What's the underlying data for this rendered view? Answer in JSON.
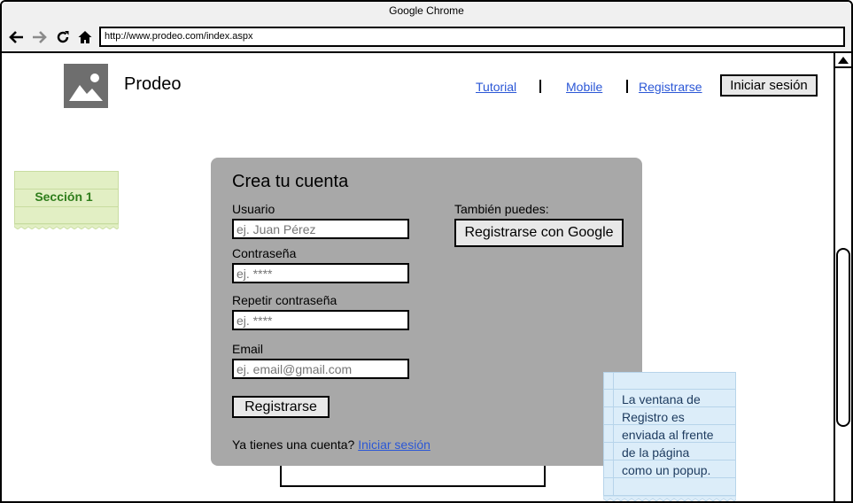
{
  "window": {
    "title": "Google Chrome"
  },
  "browser": {
    "url": "http://www.prodeo.com/index.aspx",
    "back_icon": "back-arrow-icon",
    "forward_icon": "forward-arrow-icon",
    "reload_icon": "reload-icon",
    "home_icon": "home-icon"
  },
  "header": {
    "logo_icon": "image-placeholder-icon",
    "brand": "Prodeo",
    "links": [
      "Tutorial",
      "Mobile",
      "Registrarse"
    ],
    "login_button": "Iniciar sesión"
  },
  "section_note": {
    "label": "Sección 1"
  },
  "signup": {
    "title": "Crea tu cuenta",
    "fields": [
      {
        "label": "Usuario",
        "placeholder": "ej. Juan Pérez"
      },
      {
        "label": "Contraseña",
        "placeholder": "ej. ****"
      },
      {
        "label": "Repetir contraseña",
        "placeholder": "ej. ****"
      },
      {
        "label": "Email",
        "placeholder": "ej. email@gmail.com"
      }
    ],
    "submit": "Registrarse",
    "already_text": "Ya tienes una cuenta?",
    "already_link": "Iniciar sesión",
    "alt_label": "También puedes:",
    "google_button": "Registrarse con Google"
  },
  "annotation": {
    "lines": [
      "La ventana de",
      "Registro es",
      "enviada al frente",
      "de la página",
      "como un popup."
    ]
  },
  "colors": {
    "link": "#2b57d6",
    "popup_bg": "#a8a8a8",
    "note_green": "#e2efc4",
    "note_blue": "#dcedf9",
    "section_text": "#2e7d1b"
  }
}
